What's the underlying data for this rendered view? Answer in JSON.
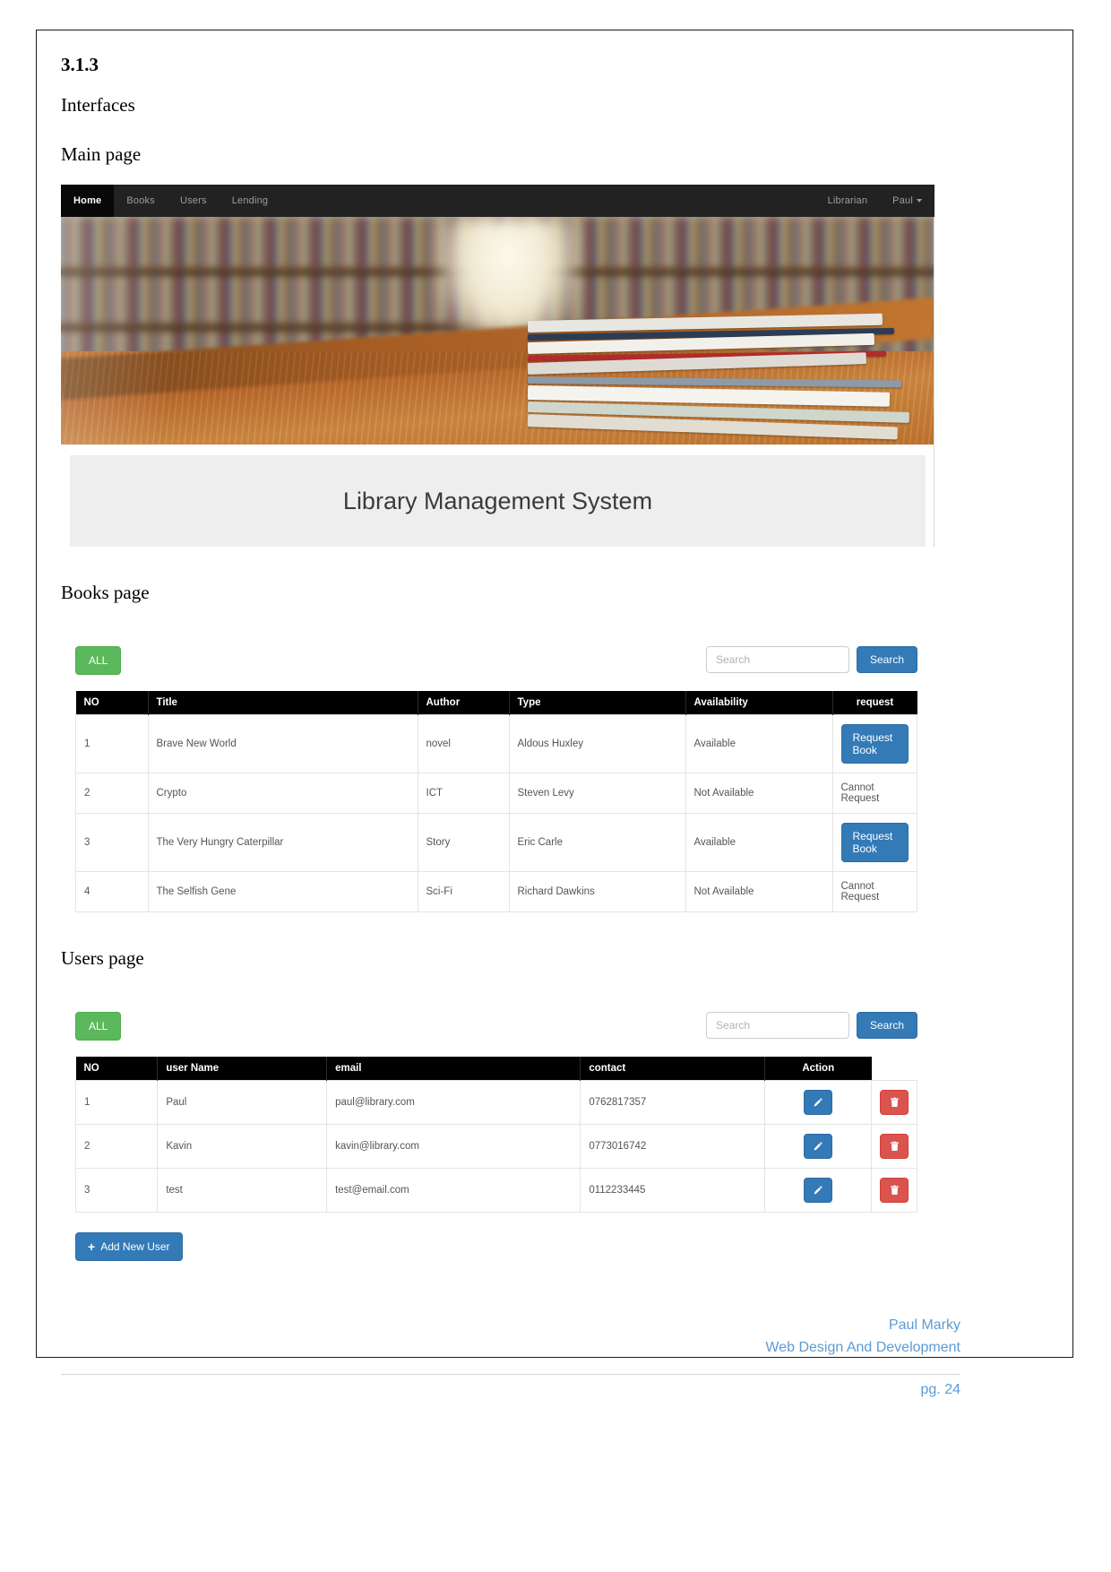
{
  "document": {
    "section_number": "3.1.3",
    "section_title": "Interfaces",
    "heading_main_page": "Main page",
    "heading_books_page": "Books page",
    "heading_users_page": "Users page"
  },
  "app": {
    "navbar": {
      "left_items": [
        {
          "label": "Home",
          "active": true
        },
        {
          "label": "Books",
          "active": false
        },
        {
          "label": "Users",
          "active": false
        },
        {
          "label": "Lending",
          "active": false
        }
      ],
      "right_items": [
        {
          "label": "Librarian"
        },
        {
          "label": "Paul"
        }
      ]
    },
    "hero": {
      "caption": "Library Management System"
    }
  },
  "books_page": {
    "all_button": "ALL",
    "search_placeholder": "Search",
    "search_value": "",
    "search_button": "Search",
    "columns": [
      "NO",
      "Title",
      "Author",
      "Type",
      "Availability",
      "request"
    ],
    "rows": [
      {
        "no": "1",
        "title": "Brave New World",
        "author": "novel",
        "type": "Aldous Huxley",
        "availability": "Available",
        "request_label": "Request Book",
        "requestable": true
      },
      {
        "no": "2",
        "title": "Crypto",
        "author": "ICT",
        "type": "Steven Levy",
        "availability": "Not Available",
        "request_label": "Cannot Request",
        "requestable": false
      },
      {
        "no": "3",
        "title": "The Very Hungry Caterpillar",
        "author": "Story",
        "type": "Eric Carle",
        "availability": "Available",
        "request_label": "Request Book",
        "requestable": true
      },
      {
        "no": "4",
        "title": "The Selfish Gene",
        "author": "Sci-Fi",
        "type": "Richard Dawkins",
        "availability": "Not Available",
        "request_label": "Cannot Request",
        "requestable": false
      }
    ]
  },
  "users_page": {
    "all_button": "ALL",
    "search_placeholder": "Search",
    "search_value": "",
    "search_button": "Search",
    "columns": [
      "NO",
      "user Name",
      "email",
      "contact",
      "Action"
    ],
    "rows": [
      {
        "no": "1",
        "user_name": "Paul",
        "email": "paul@library.com",
        "contact": "0762817357"
      },
      {
        "no": "2",
        "user_name": "Kavin",
        "email": "kavin@library.com",
        "contact": "0773016742"
      },
      {
        "no": "3",
        "user_name": "test",
        "email": "test@email.com",
        "contact": "0112233445"
      }
    ],
    "add_user_button": "Add New User"
  },
  "footer": {
    "author": "Paul Marky",
    "course": "Web Design And Development",
    "page_label": "pg. 24"
  },
  "colors": {
    "navbar_bg": "#222222",
    "primary_blue": "#337ab7",
    "success_green": "#5cb85c",
    "danger_red": "#d9534f",
    "footer_blue": "#5b9bd5",
    "table_header_bg": "#000000"
  }
}
